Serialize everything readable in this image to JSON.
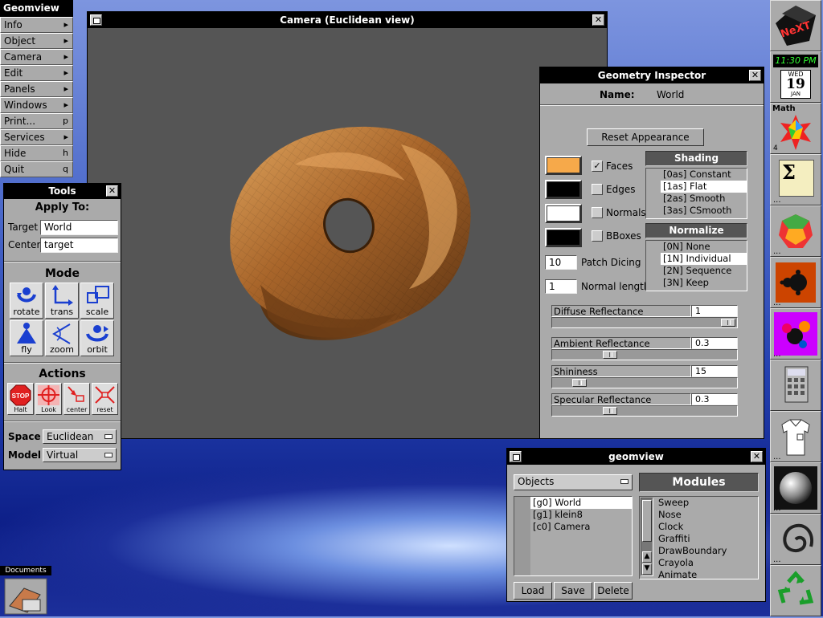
{
  "main_menu": {
    "title": "Geomview",
    "items": [
      {
        "label": "Info",
        "key": "▸"
      },
      {
        "label": "Object",
        "key": "▸"
      },
      {
        "label": "Camera",
        "key": "▸"
      },
      {
        "label": "Edit",
        "key": "▸"
      },
      {
        "label": "Panels",
        "key": "▸"
      },
      {
        "label": "Windows",
        "key": "▸"
      },
      {
        "label": "Print...",
        "key": "p"
      },
      {
        "label": "Services",
        "key": "▸"
      },
      {
        "label": "Hide",
        "key": "h"
      },
      {
        "label": "Quit",
        "key": "q"
      }
    ]
  },
  "camera_window": {
    "title": "Camera (Euclidean view)",
    "background": "#555555",
    "object_color": "#b8732a"
  },
  "tools": {
    "title": "Tools",
    "apply_to": "Apply To:",
    "target_label": "Target",
    "target_value": "World",
    "center_label": "Center",
    "center_value": "target",
    "mode_heading": "Mode",
    "modes": [
      "rotate",
      "trans",
      "scale",
      "fly",
      "zoom",
      "orbit"
    ],
    "actions_heading": "Actions",
    "actions": [
      "Halt",
      "Look",
      "center",
      "reset"
    ],
    "stop_text": "STOP",
    "space_label": "Space",
    "space_value": "Euclidean",
    "model_label": "Model",
    "model_value": "Virtual"
  },
  "inspector": {
    "title": "Geometry Inspector",
    "name_label": "Name:",
    "name_value": "World",
    "reset_label": "Reset Appearance",
    "swatch_colors": [
      "#f6a94a",
      "#000000",
      "#ffffff",
      "#000000"
    ],
    "checks": [
      {
        "label": "Faces",
        "checked": true,
        "mark": "✓"
      },
      {
        "label": "Edges",
        "checked": false,
        "mark": ""
      },
      {
        "label": "Normals",
        "checked": false,
        "mark": ""
      },
      {
        "label": "BBoxes",
        "checked": false,
        "mark": ""
      }
    ],
    "patch_dicing_value": "10",
    "patch_dicing_label": "Patch Dicing",
    "normal_length_value": "1",
    "normal_length_label": "Normal length",
    "shading_heading": "Shading",
    "shading_options": [
      "[0as] Constant",
      "[1as] Flat",
      "[2as] Smooth",
      "[3as] CSmooth"
    ],
    "shading_selected": 1,
    "normalize_heading": "Normalize",
    "normalize_options": [
      "[0N] None",
      "[1N] Individual",
      "[2N] Sequence",
      "[3N] Keep"
    ],
    "normalize_selected": 1,
    "sliders": [
      {
        "label": "Diffuse Reflectance",
        "value": "1",
        "level": 1.0
      },
      {
        "label": "Ambient Reflectance",
        "value": "0.3",
        "level": 0.3
      },
      {
        "label": "Shininess",
        "value": "15",
        "level": 0.12
      },
      {
        "label": "Specular Reflectance",
        "value": "0.3",
        "level": 0.3
      }
    ]
  },
  "geomview_panel": {
    "title": "geomview",
    "objects_popup": "Objects",
    "objects": [
      "[g0] World",
      "[g1] klein8",
      "[c0] Camera"
    ],
    "objects_selected": 0,
    "modules_heading": "Modules",
    "modules": [
      "Sweep",
      "Nose",
      "Clock",
      "Graffiti",
      "DrawBoundary",
      "Crayola",
      "Animate"
    ],
    "buttons": [
      "Load",
      "Save",
      "Delete"
    ]
  },
  "dock": {
    "clock_time": "11:30 PM",
    "clock_day": "WED",
    "clock_date": "19",
    "clock_month": "JAN",
    "math_label": "Math",
    "math_badge": "4",
    "next_logo": "NeXT",
    "sigma_glyph": "Σ"
  },
  "documents_label": "Documents"
}
